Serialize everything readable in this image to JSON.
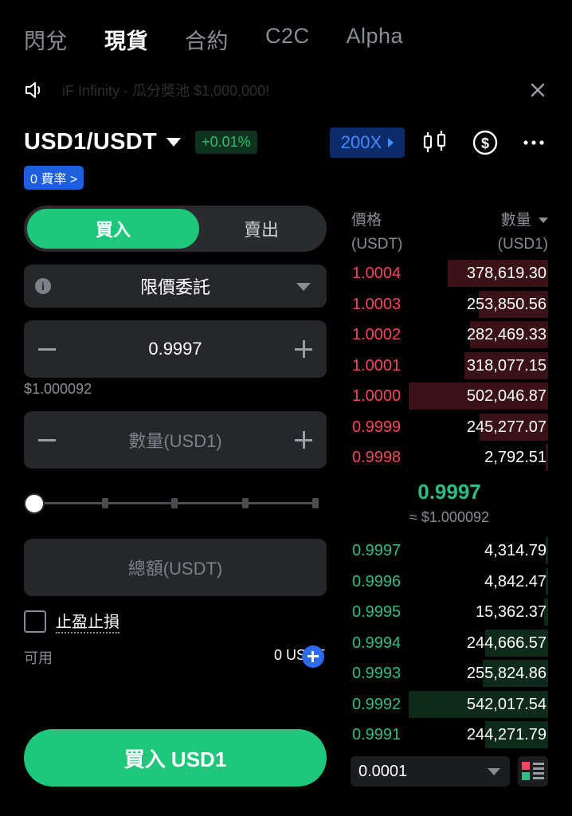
{
  "tabs": [
    "閃兌",
    "現貨",
    "合約",
    "C2C",
    "Alpha"
  ],
  "announcement": "iF Infinity · 瓜分獎池 $1,000,000!",
  "pair": {
    "name": "USD1/USDT",
    "change": "+0.01%",
    "fee_badge": "0 費率 >",
    "leverage": "200X"
  },
  "form": {
    "buy_label": "買入",
    "sell_label": "賣出",
    "order_type": "限價委託",
    "price": "0.9997",
    "price_usd": "$1.000092",
    "qty_placeholder": "數量(USD1)",
    "total_placeholder": "總額(USDT)",
    "tpsl_label": "止盈止損",
    "available_label": "可用",
    "available_value": "0 USDT",
    "submit_label": "買入  USD1"
  },
  "slider": {
    "level_percent": 0
  },
  "orderbook": {
    "price_header": "價格",
    "price_unit": "(USDT)",
    "qty_header": "數量",
    "qty_unit": "(USD1)",
    "asks": [
      {
        "price": "1.0004",
        "qty": "378,619.30",
        "depth": 0.72
      },
      {
        "price": "1.0003",
        "qty": "253,850.56",
        "depth": 0.5
      },
      {
        "price": "1.0002",
        "qty": "282,469.33",
        "depth": 0.56
      },
      {
        "price": "1.0001",
        "qty": "318,077.15",
        "depth": 0.6
      },
      {
        "price": "1.0000",
        "qty": "502,046.87",
        "depth": 1.0
      },
      {
        "price": "0.9999",
        "qty": "245,277.07",
        "depth": 0.49
      },
      {
        "price": "0.9998",
        "qty": "2,792.51",
        "depth": 0.02
      }
    ],
    "last_price": "0.9997",
    "last_price_usd": "≈ $1.000092",
    "bids": [
      {
        "price": "0.9997",
        "qty": "4,314.79",
        "depth": 0.01
      },
      {
        "price": "0.9996",
        "qty": "4,842.47",
        "depth": 0.01
      },
      {
        "price": "0.9995",
        "qty": "15,362.37",
        "depth": 0.03
      },
      {
        "price": "0.9994",
        "qty": "244,666.57",
        "depth": 0.45
      },
      {
        "price": "0.9993",
        "qty": "255,824.86",
        "depth": 0.47
      },
      {
        "price": "0.9992",
        "qty": "542,017.54",
        "depth": 1.0
      },
      {
        "price": "0.9991",
        "qty": "244,271.79",
        "depth": 0.45
      }
    ],
    "step": "0.0001"
  },
  "colors": {
    "green": "#2ebd85",
    "red": "#f6465d",
    "ask_bar": "#3a1117",
    "bid_bar": "#0e2a1b",
    "accent": "#1fc77b"
  }
}
